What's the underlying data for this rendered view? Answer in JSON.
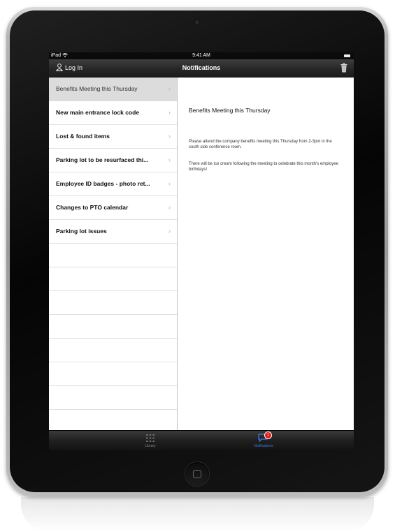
{
  "status_bar": {
    "carrier": "iPad",
    "time": "9:41 AM"
  },
  "nav_bar": {
    "login_label": "Log In",
    "title": "Notifications"
  },
  "notifications": [
    {
      "title": "Benefits Meeting this Thursday",
      "selected": true
    },
    {
      "title": "New main entrance lock code",
      "selected": false
    },
    {
      "title": "Lost & found items",
      "selected": false
    },
    {
      "title": "Parking lot to be resurfaced thi...",
      "selected": false
    },
    {
      "title": "Employee ID badges - photo ret...",
      "selected": false
    },
    {
      "title": "Changes to PTO calendar",
      "selected": false
    },
    {
      "title": "Parking lot issues",
      "selected": false
    }
  ],
  "detail": {
    "title": "Benefits Meeting this Thursday",
    "paragraph_1": "Please attend the company benefits meeting this Thursday from 2-3pm in the south side conference room.",
    "paragraph_2": "There will be ice cream following the meeting to celebrate this month's employee birthdays!"
  },
  "tab_bar": {
    "tabs": [
      {
        "label": "Library",
        "icon": "grid-icon",
        "active": false
      },
      {
        "label": "Notifications",
        "icon": "speech-bubble-icon",
        "active": true,
        "badge": "1"
      }
    ]
  },
  "colors": {
    "active_tab": "#3c7de0",
    "badge": "#e21b1b",
    "selected_row": "#dcdcdc"
  }
}
